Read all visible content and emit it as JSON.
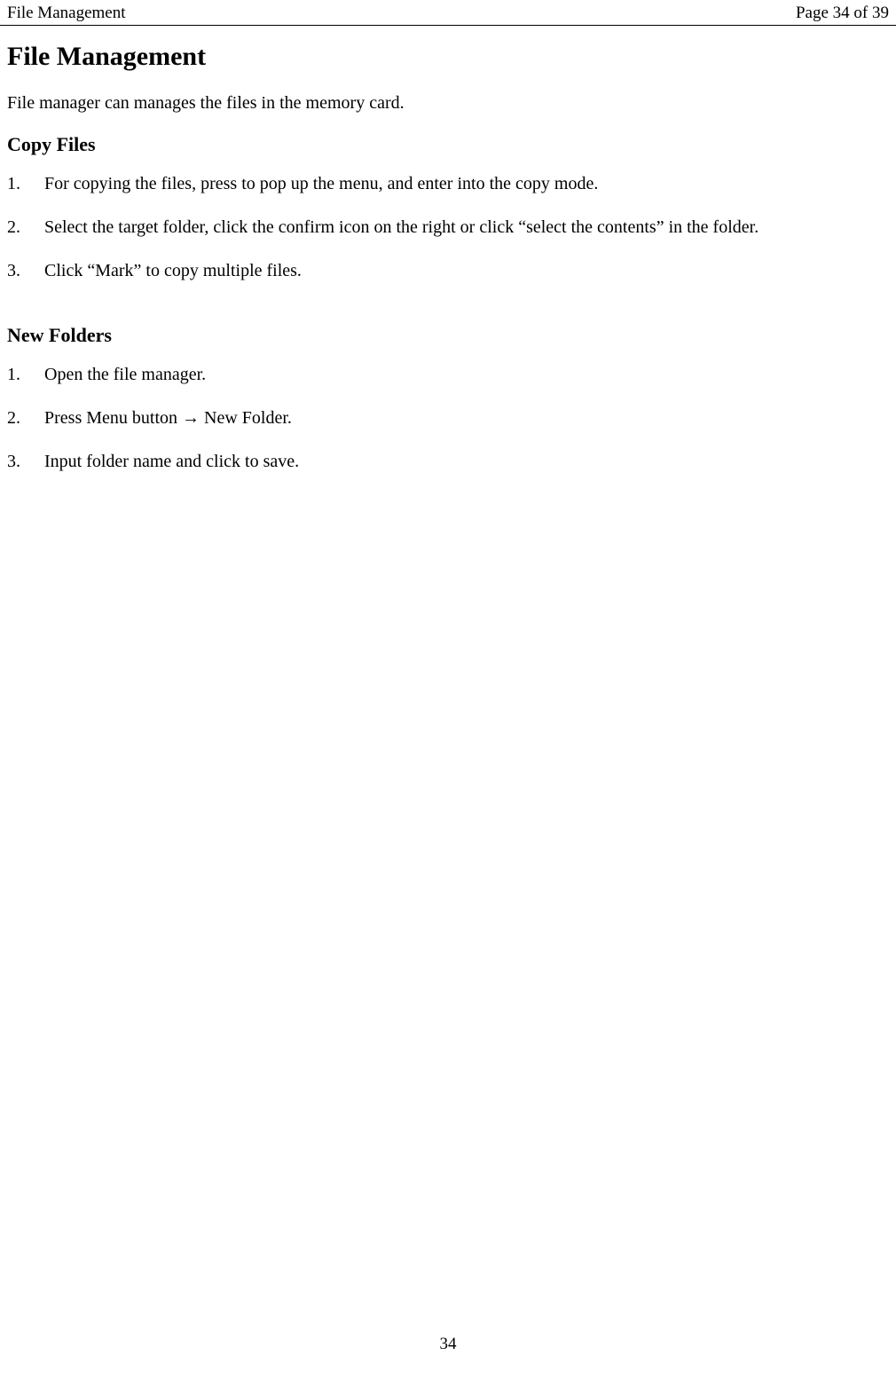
{
  "header": {
    "title": "File Management",
    "page_indicator": "Page 34 of 39"
  },
  "main": {
    "heading": "File Management",
    "intro": "File manager can manages the files in the memory card.",
    "section1": {
      "title": "Copy Files",
      "items": [
        "For copying the files, press to pop up the menu, and enter into the copy mode.",
        "Select the target folder, click the confirm icon on the right or click “select the contents” in the folder.",
        "Click “Mark” to copy multiple files."
      ]
    },
    "section2": {
      "title": "New Folders",
      "items": [
        "Open the file manager.",
        "Press Menu button → New Folder.",
        "Input folder name and click to save."
      ]
    }
  },
  "footer": {
    "page_number": "34"
  }
}
